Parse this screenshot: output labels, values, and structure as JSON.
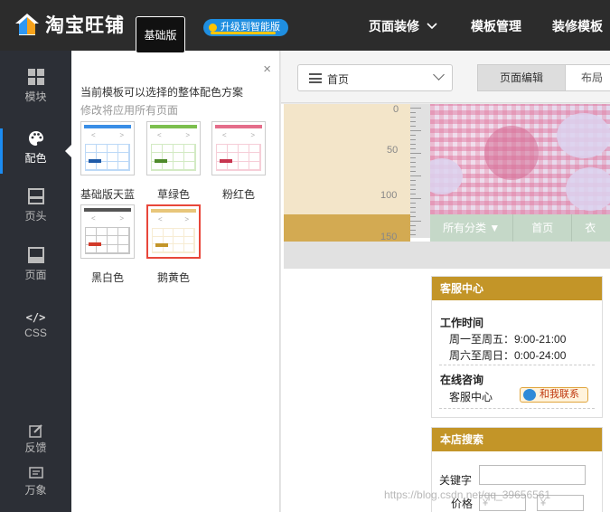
{
  "header": {
    "logo_text": "淘宝旺铺",
    "version": "基础版",
    "upgrade": "升级到智能版",
    "nav": [
      {
        "label": "页面装修"
      },
      {
        "label": "模板管理"
      },
      {
        "label": "装修模板"
      }
    ]
  },
  "sidebar": {
    "items": [
      {
        "label": "模块",
        "icon": "grid-icon"
      },
      {
        "label": "配色",
        "icon": "palette-icon"
      },
      {
        "label": "页头",
        "icon": "header-icon"
      },
      {
        "label": "页面",
        "icon": "page-icon"
      },
      {
        "label": "CSS",
        "icon_text": "</>"
      }
    ],
    "footer": [
      {
        "label": "反馈",
        "icon": "edit-icon"
      },
      {
        "label": "万象",
        "icon": "message-icon"
      }
    ],
    "active": "配色"
  },
  "color_panel": {
    "close": "×",
    "title": "当前模板可以选择的整体配色方案",
    "subtitle": "修改将应用所有页面",
    "schemes": [
      {
        "name": "基础版天蓝",
        "color": "#3a8ee6",
        "accent": "#1f5aa8"
      },
      {
        "name": "草绿色",
        "color": "#7cbf4e",
        "accent": "#4e8a2b"
      },
      {
        "name": "粉红色",
        "color": "#e46d8a",
        "accent": "#c7354f"
      },
      {
        "name": "黑白色",
        "color": "#555555",
        "accent": "#d23a2a"
      },
      {
        "name": "鹅黄色",
        "color": "#e8c67a",
        "accent": "#c39528"
      }
    ],
    "selected": "鹅黄色"
  },
  "editor": {
    "page_select": "首页",
    "tabs": [
      {
        "label": "页面编辑",
        "active": true
      },
      {
        "label": "布局",
        "active": false
      }
    ],
    "ruler": [
      "0",
      "50",
      "100",
      "150"
    ],
    "category_bar": [
      "所有分类 ▼",
      "首页",
      "衣"
    ],
    "service_module": {
      "title": "客服中心",
      "work_time_title": "工作时间",
      "weekday": "周一至周五：9:00-21:00",
      "weekend": "周六至周日：0:00-24:00",
      "online_title": "在线咨询",
      "service_label": "客服中心",
      "contact_button": "和我联系"
    },
    "search_module": {
      "title": "本店搜索",
      "keyword_label": "关键字",
      "price_label": "价格",
      "currency": "¥"
    }
  },
  "watermark": "https://blog.csdn.net/qq_39656561"
}
